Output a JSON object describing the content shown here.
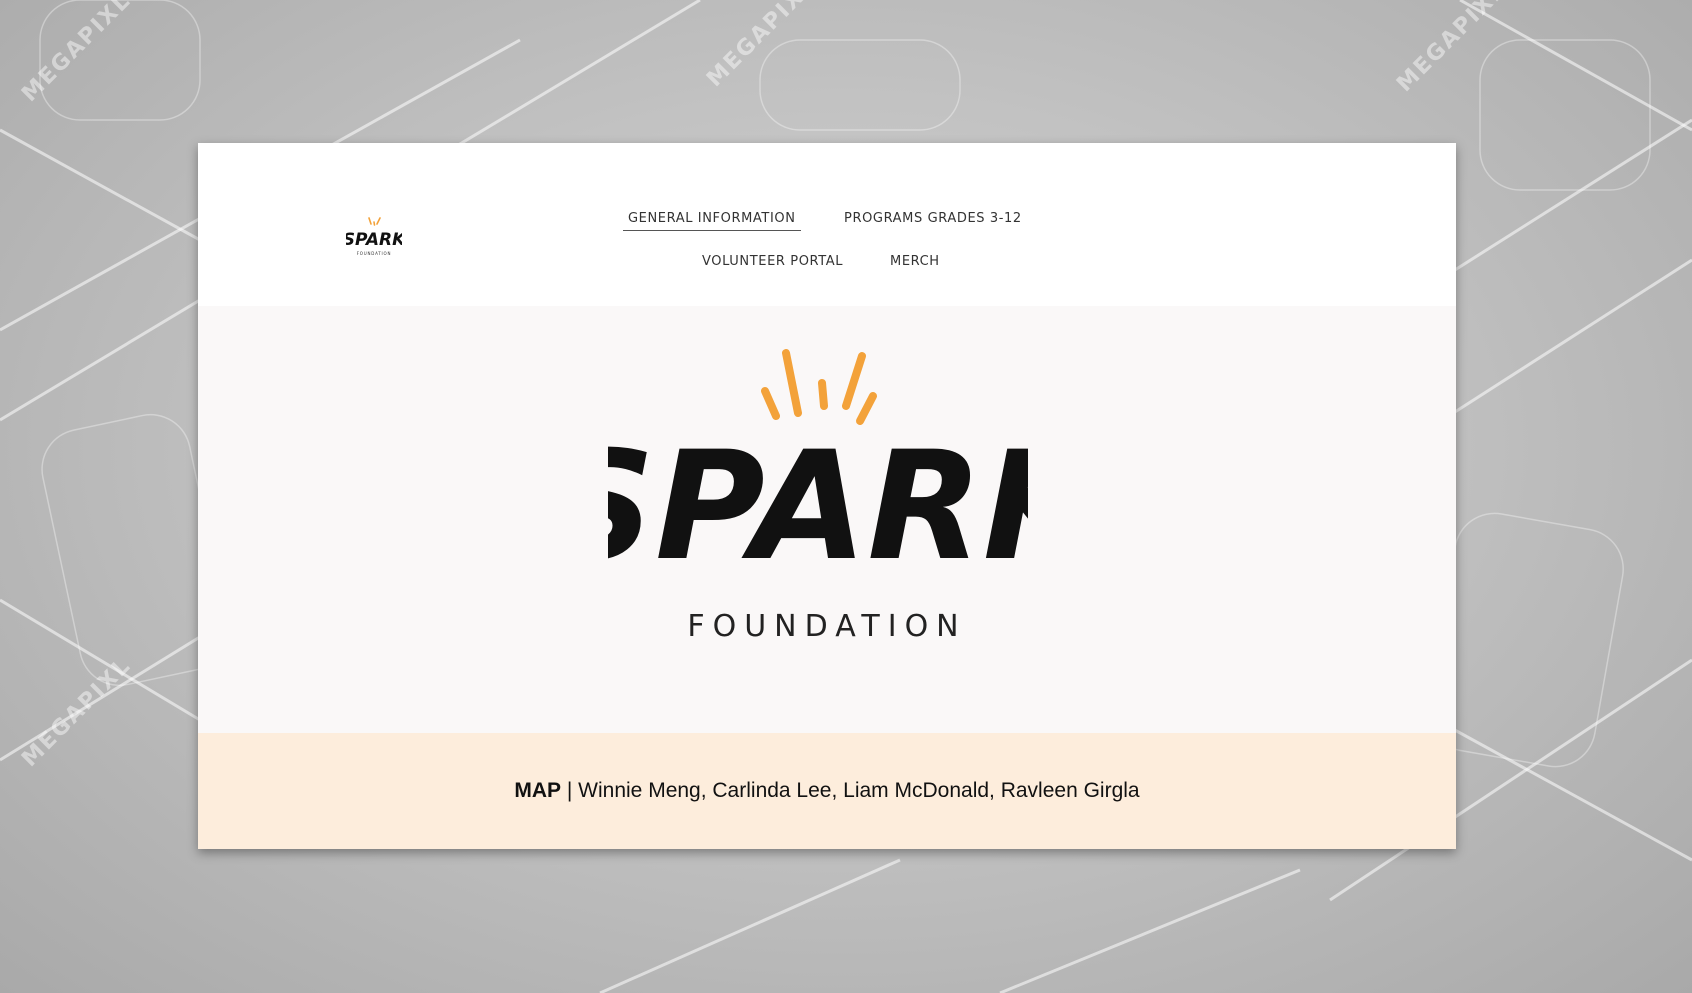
{
  "watermark": {
    "text": "MEGAPIXL"
  },
  "header": {
    "logo_text": "SPARK",
    "logo_subtext": "FOUNDATION",
    "nav": [
      {
        "label": "GENERAL INFORMATION",
        "active": true
      },
      {
        "label": "PROGRAMS GRADES 3-12",
        "active": false
      },
      {
        "label": "VOLUNTEER PORTAL",
        "active": false
      },
      {
        "label": "MERCH",
        "active": false
      }
    ]
  },
  "hero": {
    "logo_text": "SPARK",
    "subtitle": "FOUNDATION"
  },
  "credits": {
    "team": "MAP",
    "separator": " | ",
    "members": "Winnie Meng, Carlinda Lee, Liam McDonald, Ravleen Girgla"
  },
  "colors": {
    "accent_orange": "#f3a23a",
    "logo_black": "#111111",
    "credits_bg": "#fdeddc",
    "hero_bg": "#faf8f8"
  },
  "icons": [
    "spark-rays-icon"
  ]
}
